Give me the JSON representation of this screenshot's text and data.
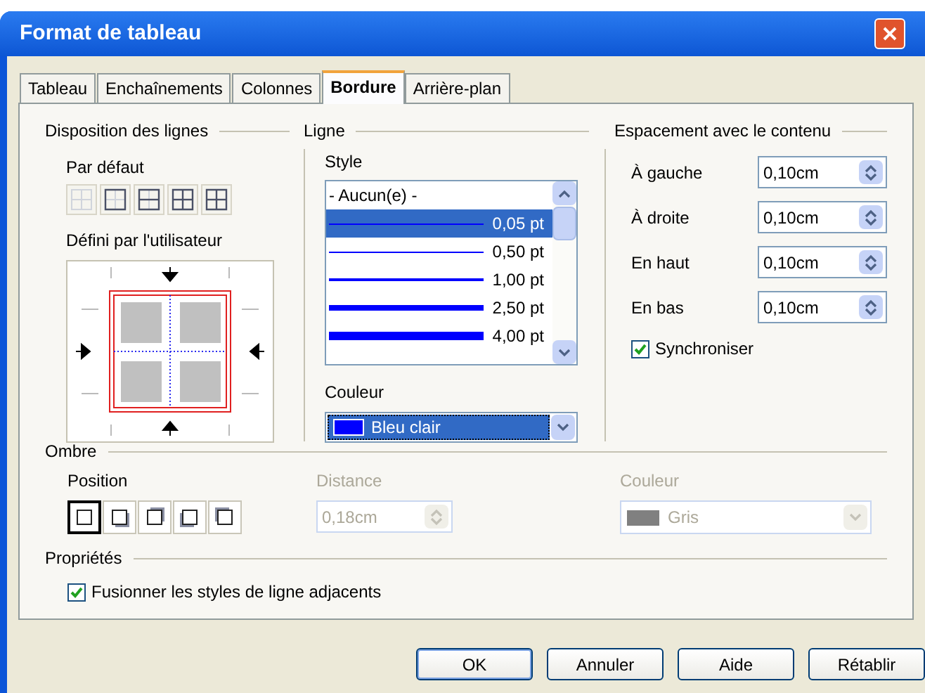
{
  "window": {
    "title": "Format de tableau"
  },
  "tabs": [
    {
      "label": "Tableau",
      "selected": false
    },
    {
      "label": "Enchaînements",
      "selected": false
    },
    {
      "label": "Colonnes",
      "selected": false
    },
    {
      "label": "Bordure",
      "selected": true
    },
    {
      "label": "Arrière-plan",
      "selected": false
    }
  ],
  "line_arrangement": {
    "title": "Disposition des lignes",
    "default_label": "Par défaut",
    "user_label": "Défini par l'utilisateur"
  },
  "line": {
    "title": "Ligne",
    "style_label": "Style",
    "styles": [
      {
        "label": "- Aucun(e) -",
        "kind": "none",
        "selected": false
      },
      {
        "label": "0,05 pt",
        "kind": "hairline",
        "selected": true
      },
      {
        "label": "0,50 pt",
        "kind": "thin",
        "selected": false
      },
      {
        "label": "1,00 pt",
        "kind": "medium",
        "selected": false
      },
      {
        "label": "2,50 pt",
        "kind": "thick",
        "selected": false
      },
      {
        "label": "4,00 pt",
        "kind": "heavy",
        "selected": false
      }
    ],
    "color_label": "Couleur",
    "color_value": "Bleu clair"
  },
  "spacing": {
    "title": "Espacement avec le contenu",
    "fields": [
      {
        "label": "À gauche",
        "value": "0,10cm"
      },
      {
        "label": "À droite",
        "value": "0,10cm"
      },
      {
        "label": "En haut",
        "value": "0,10cm"
      },
      {
        "label": "En bas",
        "value": "0,10cm"
      }
    ],
    "sync": {
      "label": "Synchroniser",
      "checked": true
    }
  },
  "shadow": {
    "title": "Ombre",
    "position_label": "Position",
    "positions": [
      {
        "kind": "none",
        "selected": true
      },
      {
        "kind": "bottom-right",
        "selected": false
      },
      {
        "kind": "top-right",
        "selected": false
      },
      {
        "kind": "bottom-left",
        "selected": false
      },
      {
        "kind": "top-left",
        "selected": false
      }
    ],
    "distance_label": "Distance",
    "distance_value": "0,18cm",
    "color_label": "Couleur",
    "color_value": "Gris",
    "disabled": true
  },
  "properties": {
    "title": "Propriétés",
    "merge": {
      "label": "Fusionner les styles de ligne adjacents",
      "checked": true
    }
  },
  "buttons": [
    {
      "label": "OK",
      "kind": "default"
    },
    {
      "label": "Annuler",
      "kind": "normal"
    },
    {
      "label": "Aide",
      "kind": "normal"
    },
    {
      "label": "Rétablir",
      "kind": "normal"
    }
  ]
}
